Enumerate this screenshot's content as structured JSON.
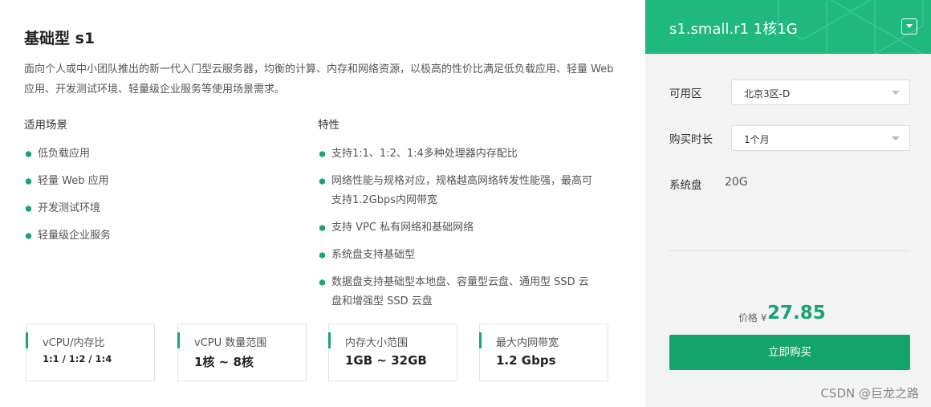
{
  "product": {
    "title": "基础型 s1",
    "description": "面向个人或中小团队推出的新一代入门型云服务器，均衡的计算、内存和网络资源，以极高的性价比满足低负载应用、轻量 Web 应用、开发测试环境、轻量级企业服务等使用场景需求。"
  },
  "scenarios": {
    "heading": "适用场景",
    "items": [
      "低负载应用",
      "轻量 Web 应用",
      "开发测试环境",
      "轻量级企业服务"
    ]
  },
  "features": {
    "heading": "特性",
    "items": [
      "支持1:1、1:2、1:4多种处理器内存配比",
      "网络性能与规格对应，规格越高网络转发性能强，最高可支持1.2Gbps内网带宽",
      "支持 VPC 私有网络和基础网络",
      "系统盘支持基础型",
      "数据盘支持基础型本地盘、容量型云盘、通用型 SSD 云盘和增强型 SSD 云盘"
    ]
  },
  "specs": [
    {
      "label": "vCPU/内存比",
      "value": "1:1 / 1:2 / 1:4"
    },
    {
      "label": "vCPU 数量范围",
      "value": "1核 ~ 8核"
    },
    {
      "label": "内存大小范围",
      "value": "1GB ~ 32GB"
    },
    {
      "label": "最大内网带宽",
      "value": "1.2 Gbps"
    }
  ],
  "purchase": {
    "instance": "s1.small.r1 1核1G",
    "zone_label": "可用区",
    "zone_value": "北京3区-D",
    "duration_label": "购买时长",
    "duration_value": "1个月",
    "disk_label": "系统盘",
    "disk_value": "20G",
    "price_label": "价格 ¥",
    "price_value": "27.85",
    "buy_label": "立即购买"
  },
  "watermark": "CSDN @巨龙之路",
  "colors": {
    "accent": "#13a46c",
    "header": "#1fb87f",
    "price": "#1aa36f"
  }
}
